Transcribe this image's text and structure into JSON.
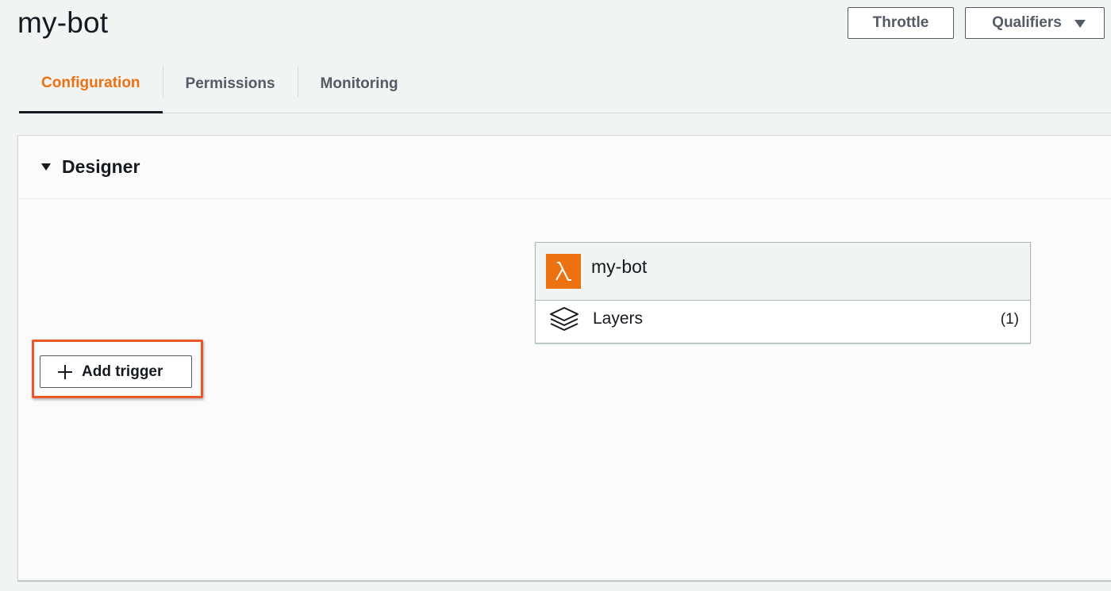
{
  "page": {
    "title": "my-bot"
  },
  "header": {
    "throttle_label": "Throttle",
    "qualifiers_label": "Qualifiers",
    "qualifiers_icon": "caret-down-icon"
  },
  "tabs": [
    {
      "label": "Configuration",
      "active": true
    },
    {
      "label": "Permissions",
      "active": false
    },
    {
      "label": "Monitoring",
      "active": false
    }
  ],
  "designer": {
    "title": "Designer",
    "add_trigger_label": "Add trigger",
    "add_trigger_icon": "plus-icon",
    "function_card": {
      "name": "my-bot",
      "icon": "lambda-icon",
      "layers_label": "Layers",
      "layers_count": "(1)",
      "layers_icon": "layers-icon"
    }
  },
  "colors": {
    "accent": "#ec7211",
    "highlight": "#e8562a",
    "text": "#16191f",
    "muted": "#545b64"
  }
}
